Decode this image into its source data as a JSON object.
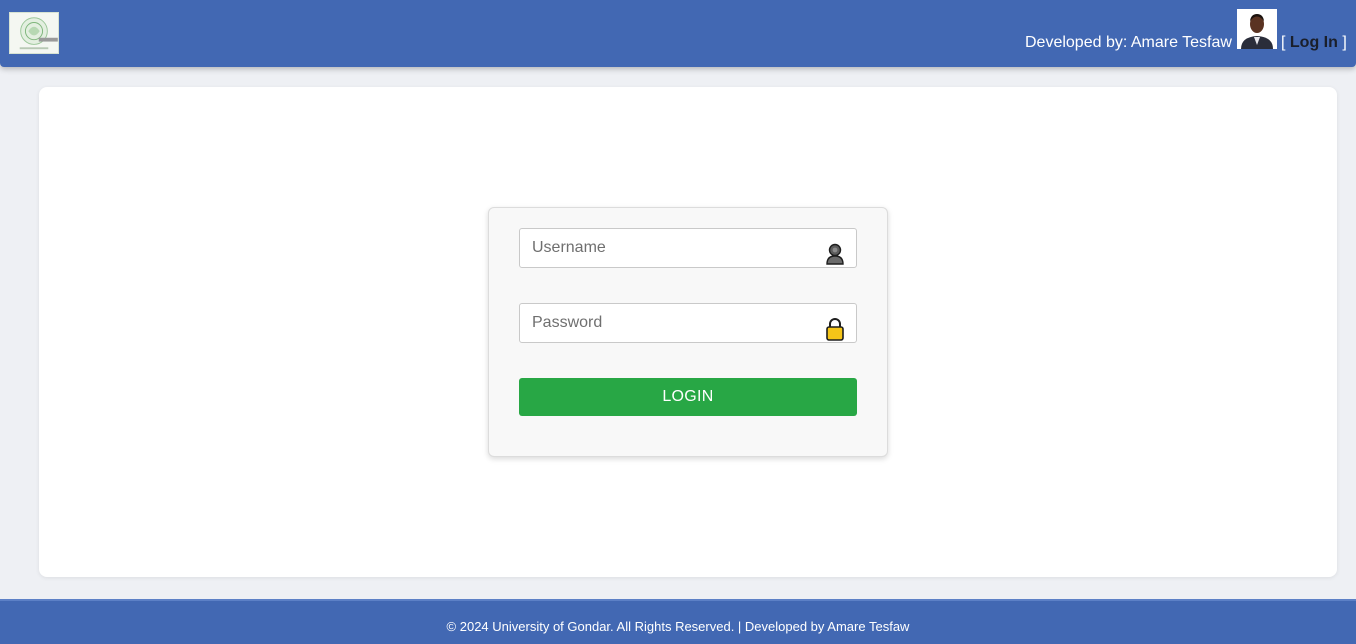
{
  "header": {
    "logo_icon": "university-logo",
    "developer_text": "Developed by: Amare Tesfaw",
    "avatar_icon": "developer-photo",
    "login_link": {
      "open_bracket": "[",
      "label": "Log In",
      "close_bracket": "]"
    },
    "background_color": "#4268b3"
  },
  "login_form": {
    "username": {
      "value": "",
      "placeholder": "Username",
      "icon": "user-icon"
    },
    "password": {
      "value": "",
      "placeholder": "Password",
      "icon": "lock-icon"
    },
    "submit_label": "LOGIN",
    "submit_color": "#28a745"
  },
  "footer": {
    "text": "© 2024 University of Gondar. All Rights Reserved. | Developed by Amare Tesfaw"
  }
}
